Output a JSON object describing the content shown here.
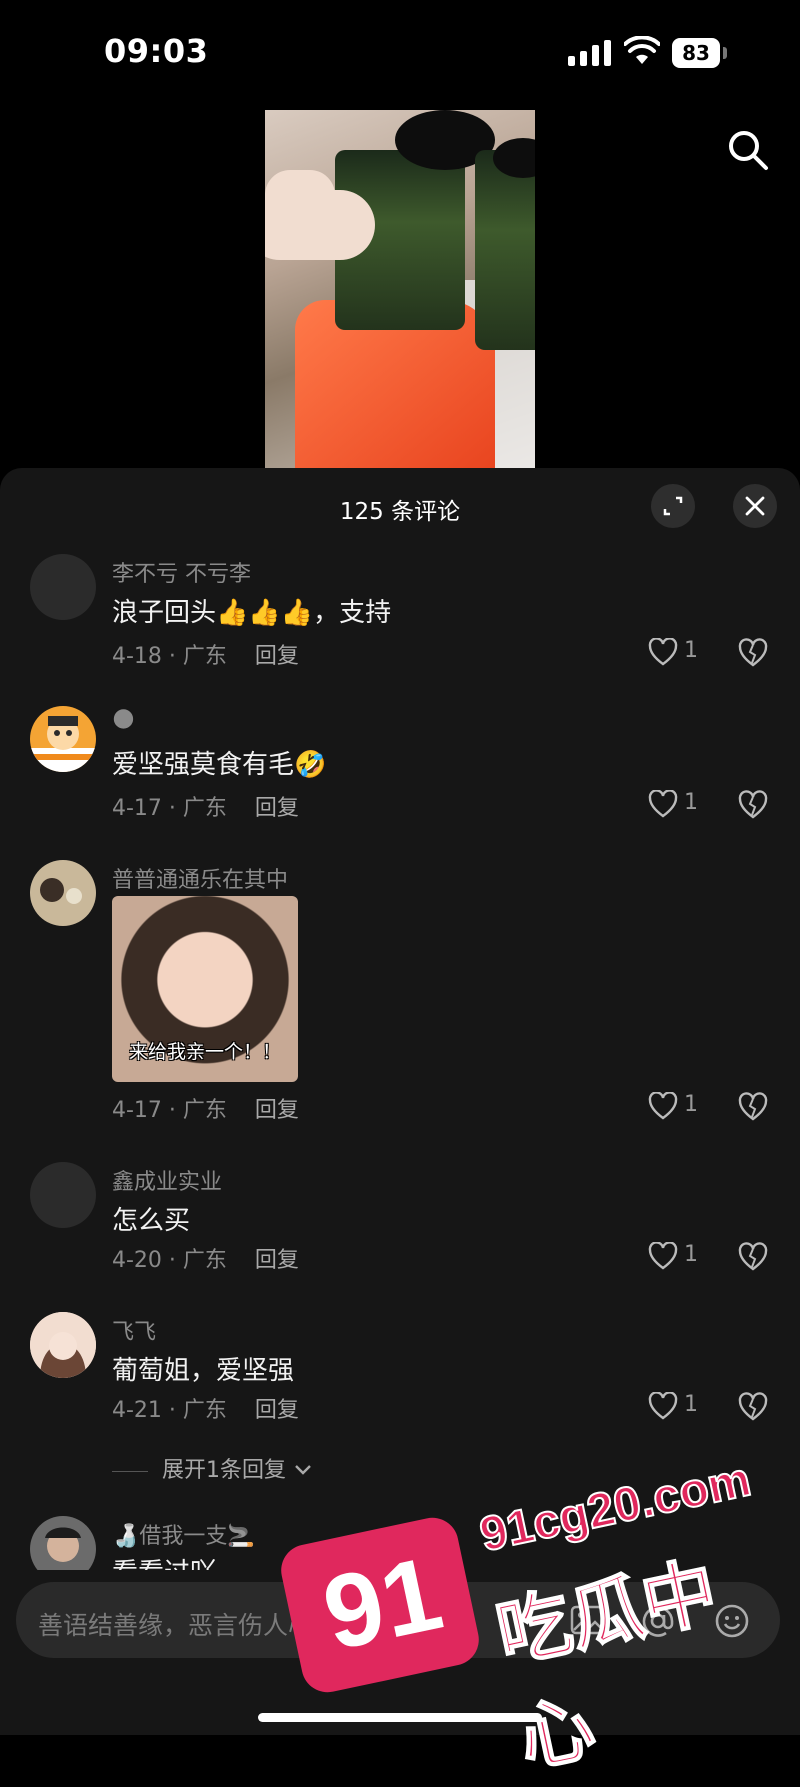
{
  "status_bar": {
    "time": "09:03",
    "battery": "83"
  },
  "video": {
    "icon": "search-icon"
  },
  "comments_panel": {
    "title": "125 条评论",
    "comments": [
      {
        "user": "李不亏 不亏李",
        "text": "浪子回头👍👍👍，支持",
        "date": "4-18 · 广东",
        "reply": "回复",
        "likes": "1"
      },
      {
        "user": "🌑",
        "text": "爱坚强莫食有毛🤣",
        "date": "4-17 · 广东",
        "reply": "回复",
        "likes": "1"
      },
      {
        "user": "普普通通乐在其中",
        "text": "",
        "sticker_caption": "来给我亲一个！！",
        "date": "4-17 · 广东",
        "reply": "回复",
        "likes": "1"
      },
      {
        "user": "鑫成业实业",
        "text": "怎么买",
        "date": "4-20 · 广东",
        "reply": "回复",
        "likes": "1"
      },
      {
        "user": "飞飞",
        "text": "葡萄姐，爱坚强",
        "date": "4-21 · 广东",
        "reply": "回复",
        "likes": "1"
      },
      {
        "user": "🍶借我一支🚬",
        "text": "看看过吖"
      }
    ],
    "expand_replies": "展开1条回复"
  },
  "input": {
    "placeholder": "善语结善缘，恶言伤人心"
  },
  "watermark": {
    "number": "91",
    "url": "91cg20.com",
    "name": "吃瓜中心"
  }
}
